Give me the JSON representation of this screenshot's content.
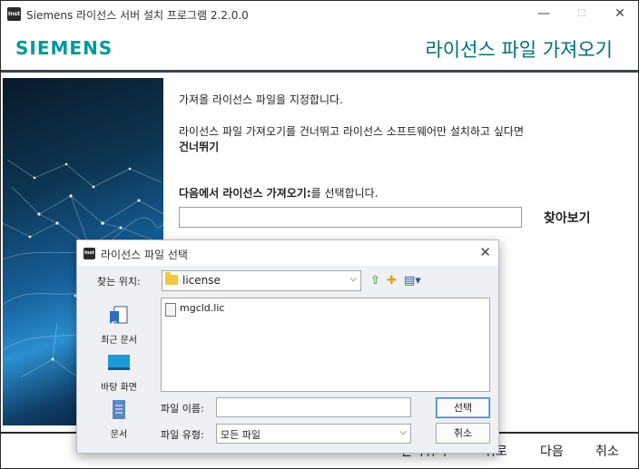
{
  "window": {
    "title": "Siemens 라이선스 서버 설치 프로그램 2.2.0.0",
    "icon_text": "Inst",
    "controls": {
      "minimize": "—",
      "maximize": "☐",
      "close": "✕"
    }
  },
  "header": {
    "brand": "SIEMENS",
    "page_title": "라이선스 파일 가져오기",
    "brand_color": "#009999",
    "title_color": "#00707a"
  },
  "main": {
    "instruction": "가져올 라이선스 파일을 지정합니다.",
    "skip_line1": "라이선스 파일 가져오기를 건너뛰고 라이선스 소프트웨어만 설치하고 싶다면",
    "skip_line2": "건너뛰기",
    "import_prefix": "다음에서 라이선스 가져오기:",
    "import_suffix": "를 선택합니다.",
    "path_value": "",
    "browse_label": "찾아보기"
  },
  "footer": {
    "skip_label": "건너뛰기",
    "back_label": "뒤로",
    "next_label": "다음",
    "cancel_label": "취소"
  },
  "dialog": {
    "title": "라이선스 파일 선택",
    "icon_text": "Inst",
    "look_in_label": "찾는 위치:",
    "look_in_value": "license",
    "places": [
      {
        "label": "최근 문서",
        "icon": "recent-documents-icon"
      },
      {
        "label": "바탕 화면",
        "icon": "desktop-icon"
      },
      {
        "label": "문서",
        "icon": "documents-icon"
      }
    ],
    "files": [
      "mgcld.lic"
    ],
    "file_name_label": "파일 이름:",
    "file_name_value": "",
    "file_type_label": "파일 유형:",
    "file_type_value": "모든 파일",
    "open_label": "선택",
    "cancel_label": "취소"
  }
}
